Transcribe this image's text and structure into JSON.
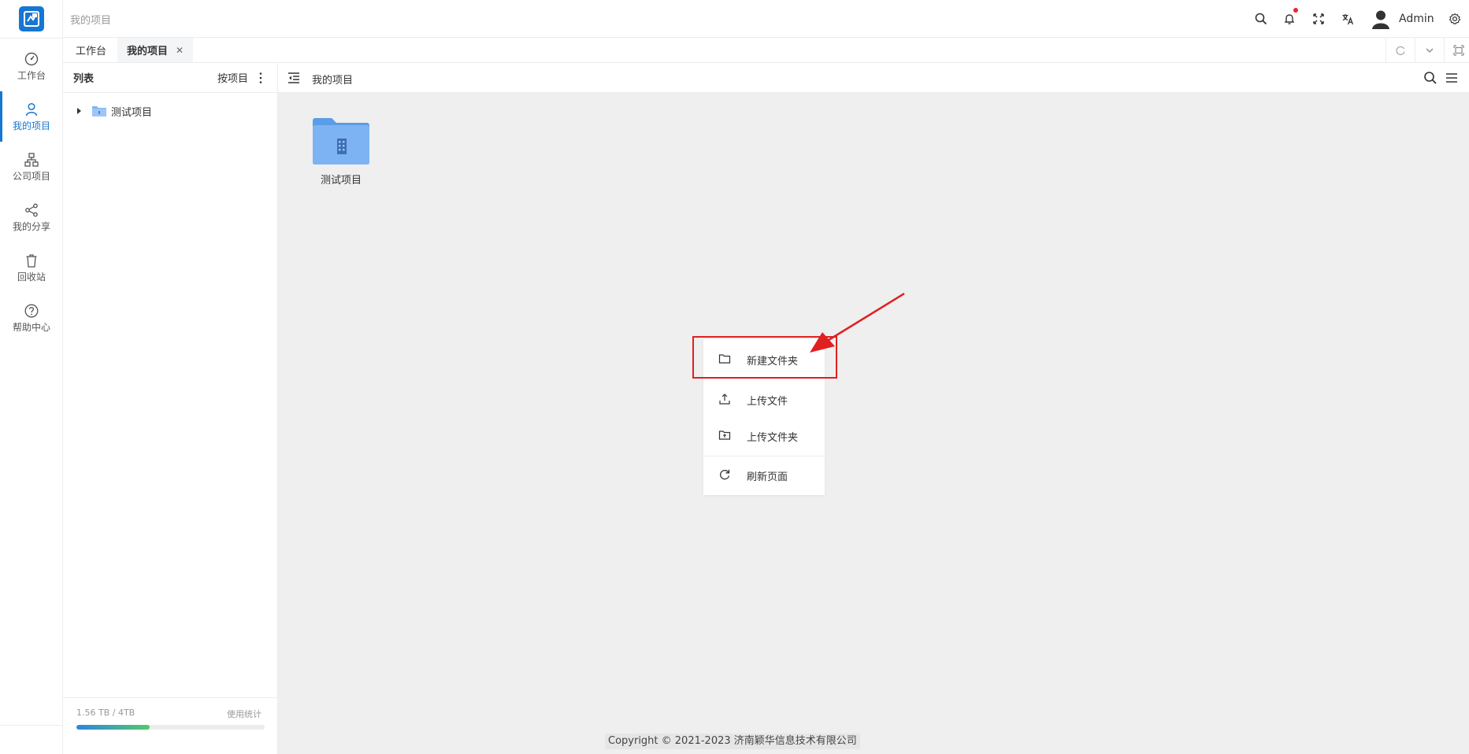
{
  "colors": {
    "brand": "#1677d2",
    "highlight": "#e02020",
    "content_bg": "#efefef"
  },
  "header": {
    "breadcrumb": "我的项目",
    "user_name": "Admin",
    "icons": [
      "search-icon",
      "bell-icon",
      "fullscreen-icon",
      "translate-icon",
      "user-avatar-icon",
      "gear-icon"
    ]
  },
  "rail": {
    "items": [
      {
        "label": "工作台",
        "icon": "dashboard-icon"
      },
      {
        "label": "我的项目",
        "icon": "user-icon",
        "active": true
      },
      {
        "label": "公司项目",
        "icon": "org-tree-icon"
      },
      {
        "label": "我的分享",
        "icon": "share-icon"
      },
      {
        "label": "回收站",
        "icon": "trash-icon"
      },
      {
        "label": "帮助中心",
        "icon": "help-icon"
      }
    ]
  },
  "tabs": [
    {
      "label": "工作台"
    },
    {
      "label": "我的项目",
      "active": true,
      "closable": true
    }
  ],
  "panel": {
    "title": "列表",
    "sort_label": "按项目",
    "tree": [
      {
        "name": "测试项目"
      }
    ],
    "usage_text": "1.56 TB / 4TB",
    "usage_fraction": 0.39,
    "usage_link": "使用统计"
  },
  "content": {
    "title": "我的项目",
    "files": [
      {
        "name": "测试项目",
        "type": "folder"
      }
    ]
  },
  "context_menu": {
    "items": [
      {
        "label": "新建文件夹",
        "icon": "folder-icon"
      },
      {
        "label": "上传文件",
        "icon": "upload-icon"
      },
      {
        "label": "上传文件夹",
        "icon": "folder-upload-icon"
      },
      {
        "label": "刷新页面",
        "icon": "refresh-icon"
      }
    ]
  },
  "footer": {
    "copyright": "Copyright © 2021-2023 济南颖华信息技术有限公司"
  }
}
